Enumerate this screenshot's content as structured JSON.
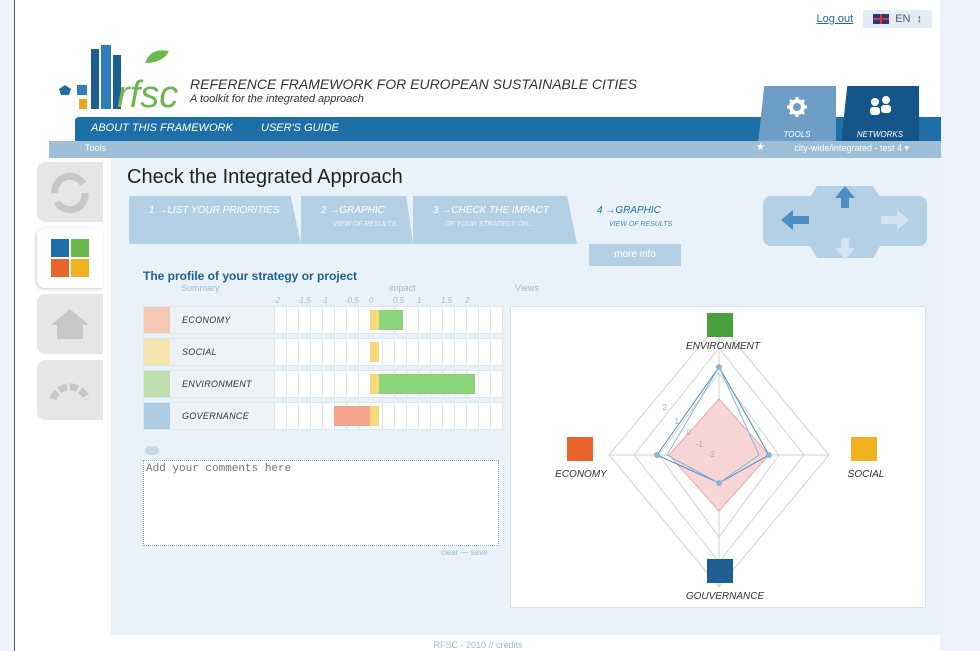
{
  "header": {
    "logout": "Log out",
    "language": "EN",
    "brand_title": "REFERENCE FRAMEWORK FOR EUROPEAN SUSTAINABLE CITIES",
    "brand_subtitle": "A toolkit for the integrated approach",
    "logo_text": "rfsc"
  },
  "nav": {
    "about": "ABOUT THIS FRAMEWORK",
    "guide": "USER'S GUIDE",
    "tools": "TOOLS",
    "networks": "NETWORKS"
  },
  "subbar": {
    "tools": "Tools",
    "project": "city-wide/integrated - test 4 ▾"
  },
  "page": {
    "title": "Check the Integrated Approach",
    "steps": [
      {
        "label": "1 →LIST YOUR PRIORITIES",
        "sub": ""
      },
      {
        "label": "2 →GRAPHIC",
        "sub": "VIEW OF RESULTS"
      },
      {
        "label": "3 →CHECK THE IMPACT",
        "sub": "OF YOUR STRATEGY ON..."
      },
      {
        "label": "4 →GRAPHIC",
        "sub": "VIEW OF RESULTS"
      }
    ],
    "more_info": "more info"
  },
  "profile": {
    "title": "The profile of your strategy or project",
    "summary": "Summary",
    "impact": "impact",
    "views": "Views",
    "scale": [
      "-2",
      "-1.5",
      "-1",
      "-0.5",
      "0",
      "0.5",
      "1",
      "1.5",
      "2"
    ],
    "rows": [
      {
        "name": "ECONOMY",
        "value": 0.5,
        "color": "#e8855a"
      },
      {
        "name": "SOCIAL",
        "value": 0,
        "color": "#e8c64a"
      },
      {
        "name": "ENVIRONMENT",
        "value": 2,
        "color": "#6bb84a"
      },
      {
        "name": "GOVERNANCE",
        "value": -0.75,
        "color": "#4a8ec4"
      }
    ],
    "comment_placeholder": "Add your comments here",
    "clear_save": "clear — save"
  },
  "radar": {
    "environment": "ENVIRONMENT",
    "social": "SOCIAL",
    "economy": "ECONOMY",
    "governance": "GOUVERNANCE",
    "ticks": [
      "2",
      "1",
      "0",
      "-1",
      "-2"
    ]
  },
  "footer": "RFSC - 2010 // credits"
}
